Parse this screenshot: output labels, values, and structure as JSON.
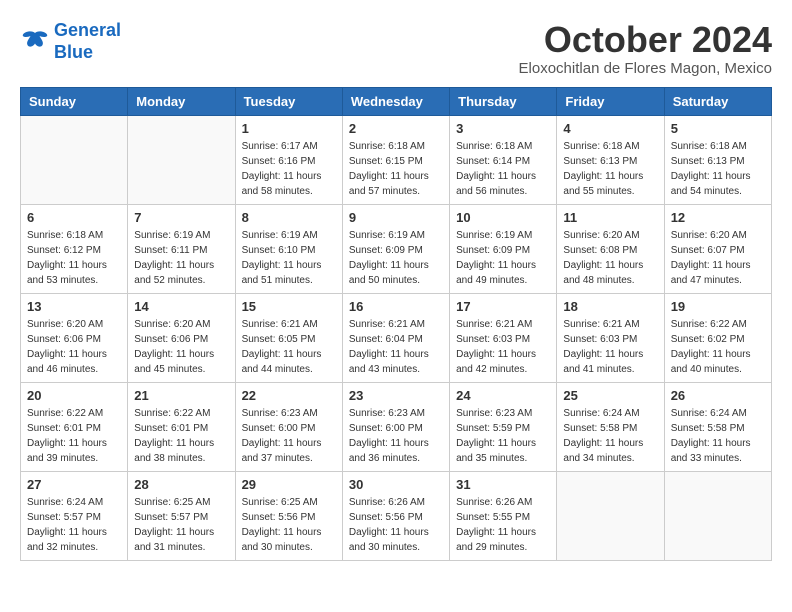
{
  "header": {
    "logo_line1": "General",
    "logo_line2": "Blue",
    "month_title": "October 2024",
    "subtitle": "Eloxochitlan de Flores Magon, Mexico"
  },
  "weekdays": [
    "Sunday",
    "Monday",
    "Tuesday",
    "Wednesday",
    "Thursday",
    "Friday",
    "Saturday"
  ],
  "weeks": [
    [
      {
        "day": "",
        "info": ""
      },
      {
        "day": "",
        "info": ""
      },
      {
        "day": "1",
        "info": "Sunrise: 6:17 AM\nSunset: 6:16 PM\nDaylight: 11 hours and 58 minutes."
      },
      {
        "day": "2",
        "info": "Sunrise: 6:18 AM\nSunset: 6:15 PM\nDaylight: 11 hours and 57 minutes."
      },
      {
        "day": "3",
        "info": "Sunrise: 6:18 AM\nSunset: 6:14 PM\nDaylight: 11 hours and 56 minutes."
      },
      {
        "day": "4",
        "info": "Sunrise: 6:18 AM\nSunset: 6:13 PM\nDaylight: 11 hours and 55 minutes."
      },
      {
        "day": "5",
        "info": "Sunrise: 6:18 AM\nSunset: 6:13 PM\nDaylight: 11 hours and 54 minutes."
      }
    ],
    [
      {
        "day": "6",
        "info": "Sunrise: 6:18 AM\nSunset: 6:12 PM\nDaylight: 11 hours and 53 minutes."
      },
      {
        "day": "7",
        "info": "Sunrise: 6:19 AM\nSunset: 6:11 PM\nDaylight: 11 hours and 52 minutes."
      },
      {
        "day": "8",
        "info": "Sunrise: 6:19 AM\nSunset: 6:10 PM\nDaylight: 11 hours and 51 minutes."
      },
      {
        "day": "9",
        "info": "Sunrise: 6:19 AM\nSunset: 6:09 PM\nDaylight: 11 hours and 50 minutes."
      },
      {
        "day": "10",
        "info": "Sunrise: 6:19 AM\nSunset: 6:09 PM\nDaylight: 11 hours and 49 minutes."
      },
      {
        "day": "11",
        "info": "Sunrise: 6:20 AM\nSunset: 6:08 PM\nDaylight: 11 hours and 48 minutes."
      },
      {
        "day": "12",
        "info": "Sunrise: 6:20 AM\nSunset: 6:07 PM\nDaylight: 11 hours and 47 minutes."
      }
    ],
    [
      {
        "day": "13",
        "info": "Sunrise: 6:20 AM\nSunset: 6:06 PM\nDaylight: 11 hours and 46 minutes."
      },
      {
        "day": "14",
        "info": "Sunrise: 6:20 AM\nSunset: 6:06 PM\nDaylight: 11 hours and 45 minutes."
      },
      {
        "day": "15",
        "info": "Sunrise: 6:21 AM\nSunset: 6:05 PM\nDaylight: 11 hours and 44 minutes."
      },
      {
        "day": "16",
        "info": "Sunrise: 6:21 AM\nSunset: 6:04 PM\nDaylight: 11 hours and 43 minutes."
      },
      {
        "day": "17",
        "info": "Sunrise: 6:21 AM\nSunset: 6:03 PM\nDaylight: 11 hours and 42 minutes."
      },
      {
        "day": "18",
        "info": "Sunrise: 6:21 AM\nSunset: 6:03 PM\nDaylight: 11 hours and 41 minutes."
      },
      {
        "day": "19",
        "info": "Sunrise: 6:22 AM\nSunset: 6:02 PM\nDaylight: 11 hours and 40 minutes."
      }
    ],
    [
      {
        "day": "20",
        "info": "Sunrise: 6:22 AM\nSunset: 6:01 PM\nDaylight: 11 hours and 39 minutes."
      },
      {
        "day": "21",
        "info": "Sunrise: 6:22 AM\nSunset: 6:01 PM\nDaylight: 11 hours and 38 minutes."
      },
      {
        "day": "22",
        "info": "Sunrise: 6:23 AM\nSunset: 6:00 PM\nDaylight: 11 hours and 37 minutes."
      },
      {
        "day": "23",
        "info": "Sunrise: 6:23 AM\nSunset: 6:00 PM\nDaylight: 11 hours and 36 minutes."
      },
      {
        "day": "24",
        "info": "Sunrise: 6:23 AM\nSunset: 5:59 PM\nDaylight: 11 hours and 35 minutes."
      },
      {
        "day": "25",
        "info": "Sunrise: 6:24 AM\nSunset: 5:58 PM\nDaylight: 11 hours and 34 minutes."
      },
      {
        "day": "26",
        "info": "Sunrise: 6:24 AM\nSunset: 5:58 PM\nDaylight: 11 hours and 33 minutes."
      }
    ],
    [
      {
        "day": "27",
        "info": "Sunrise: 6:24 AM\nSunset: 5:57 PM\nDaylight: 11 hours and 32 minutes."
      },
      {
        "day": "28",
        "info": "Sunrise: 6:25 AM\nSunset: 5:57 PM\nDaylight: 11 hours and 31 minutes."
      },
      {
        "day": "29",
        "info": "Sunrise: 6:25 AM\nSunset: 5:56 PM\nDaylight: 11 hours and 30 minutes."
      },
      {
        "day": "30",
        "info": "Sunrise: 6:26 AM\nSunset: 5:56 PM\nDaylight: 11 hours and 30 minutes."
      },
      {
        "day": "31",
        "info": "Sunrise: 6:26 AM\nSunset: 5:55 PM\nDaylight: 11 hours and 29 minutes."
      },
      {
        "day": "",
        "info": ""
      },
      {
        "day": "",
        "info": ""
      }
    ]
  ]
}
